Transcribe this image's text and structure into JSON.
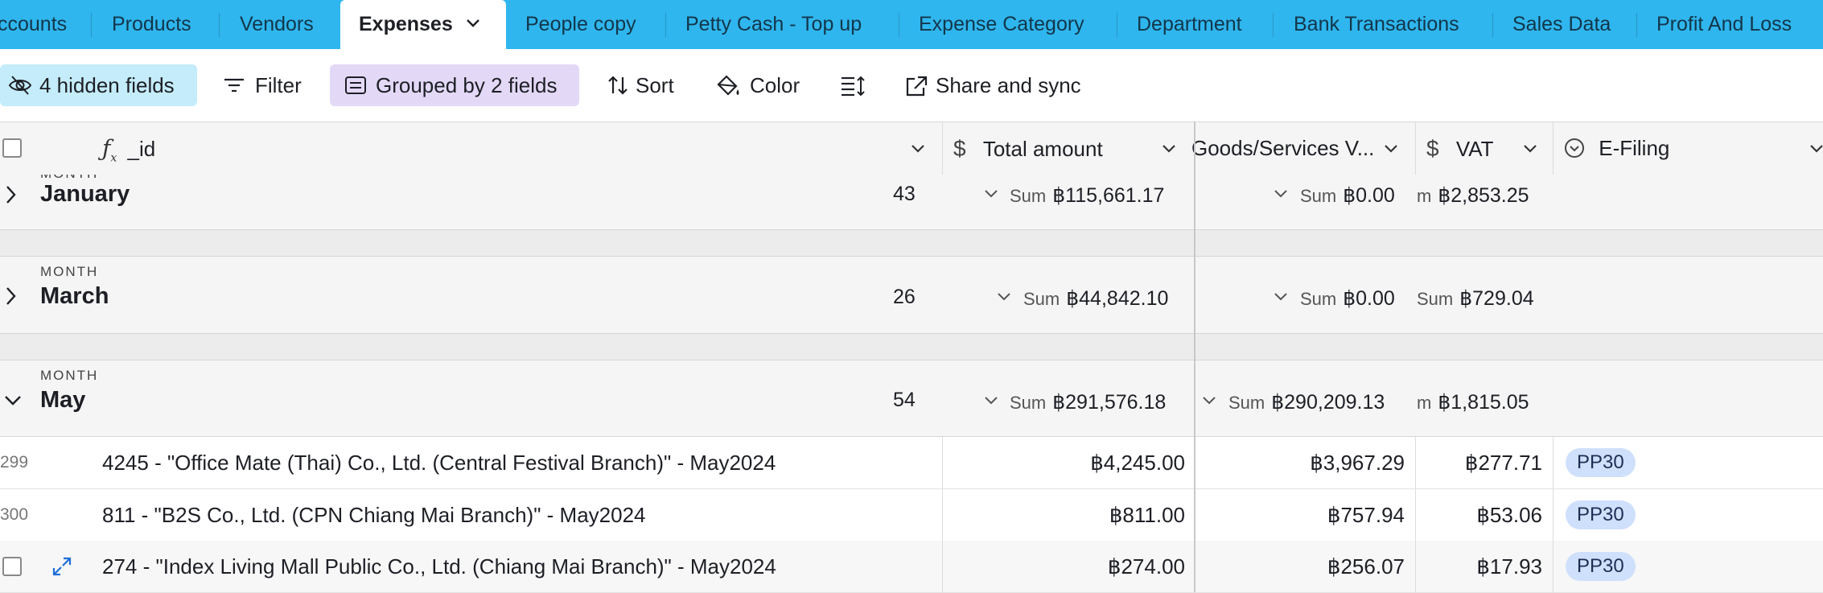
{
  "tabs": [
    {
      "label": "ccounts",
      "active": false
    },
    {
      "label": "Products",
      "active": false
    },
    {
      "label": "Vendors",
      "active": false
    },
    {
      "label": "Expenses",
      "active": true
    },
    {
      "label": "People copy",
      "active": false
    },
    {
      "label": "Petty Cash - Top up",
      "active": false
    },
    {
      "label": "Expense Category",
      "active": false
    },
    {
      "label": "Department",
      "active": false
    },
    {
      "label": "Bank Transactions",
      "active": false
    },
    {
      "label": "Sales Data",
      "active": false
    },
    {
      "label": "Profit And Loss",
      "active": false
    }
  ],
  "toolbar": {
    "hidden_fields": "4 hidden fields",
    "filter": "Filter",
    "grouped": "Grouped by 2 fields",
    "sort": "Sort",
    "color": "Color",
    "share": "Share and sync"
  },
  "columns": {
    "id": "_id",
    "total": "Total amount",
    "goods": "Goods/Services V...",
    "vat": "VAT",
    "efiling": "E-Filing"
  },
  "groups": [
    {
      "level_label": "MONTH",
      "name": "January",
      "count": "43",
      "sum_label": "Sum",
      "total_sum": "฿115,661.17",
      "goods_sum": "฿0.00",
      "vat_prefix": "m",
      "vat_sum": "฿2,853.25"
    },
    {
      "level_label": "MONTH",
      "name": "March",
      "count": "26",
      "sum_label": "Sum",
      "total_sum": "฿44,842.10",
      "goods_sum": "฿0.00",
      "vat_prefix": "Sum",
      "vat_sum": "฿729.04"
    },
    {
      "level_label": "MONTH",
      "name": "May",
      "count": "54",
      "sum_label": "Sum",
      "total_sum": "฿291,576.18",
      "goods_sum": "฿290,209.13",
      "vat_prefix": "m",
      "vat_sum": "฿1,815.05"
    }
  ],
  "rows": [
    {
      "num": "299",
      "id": "4245 - \"Office Mate (Thai) Co., Ltd. (Central Festival Branch)\" - May2024",
      "total": "฿4,245.00",
      "goods": "฿3,967.29",
      "vat": "฿277.71",
      "efiling": "PP30"
    },
    {
      "num": "300",
      "id": "811 - \"B2S Co., Ltd. (CPN Chiang Mai Branch)\" - May2024",
      "total": "฿811.00",
      "goods": "฿757.94",
      "vat": "฿53.06",
      "efiling": "PP30"
    },
    {
      "num": "",
      "id": "274 - \"Index Living Mall Public Co., Ltd. (Chiang Mai Branch)\" - May2024",
      "total": "฿274.00",
      "goods": "฿256.07",
      "vat": "฿17.93",
      "efiling": "PP30"
    }
  ],
  "colors": {
    "tab_bar": "#2fb6ee",
    "hidden_fields_bg": "#c4ecfb",
    "grouped_bg": "#e3d9f7",
    "pill_bg": "#cfe0fc"
  }
}
